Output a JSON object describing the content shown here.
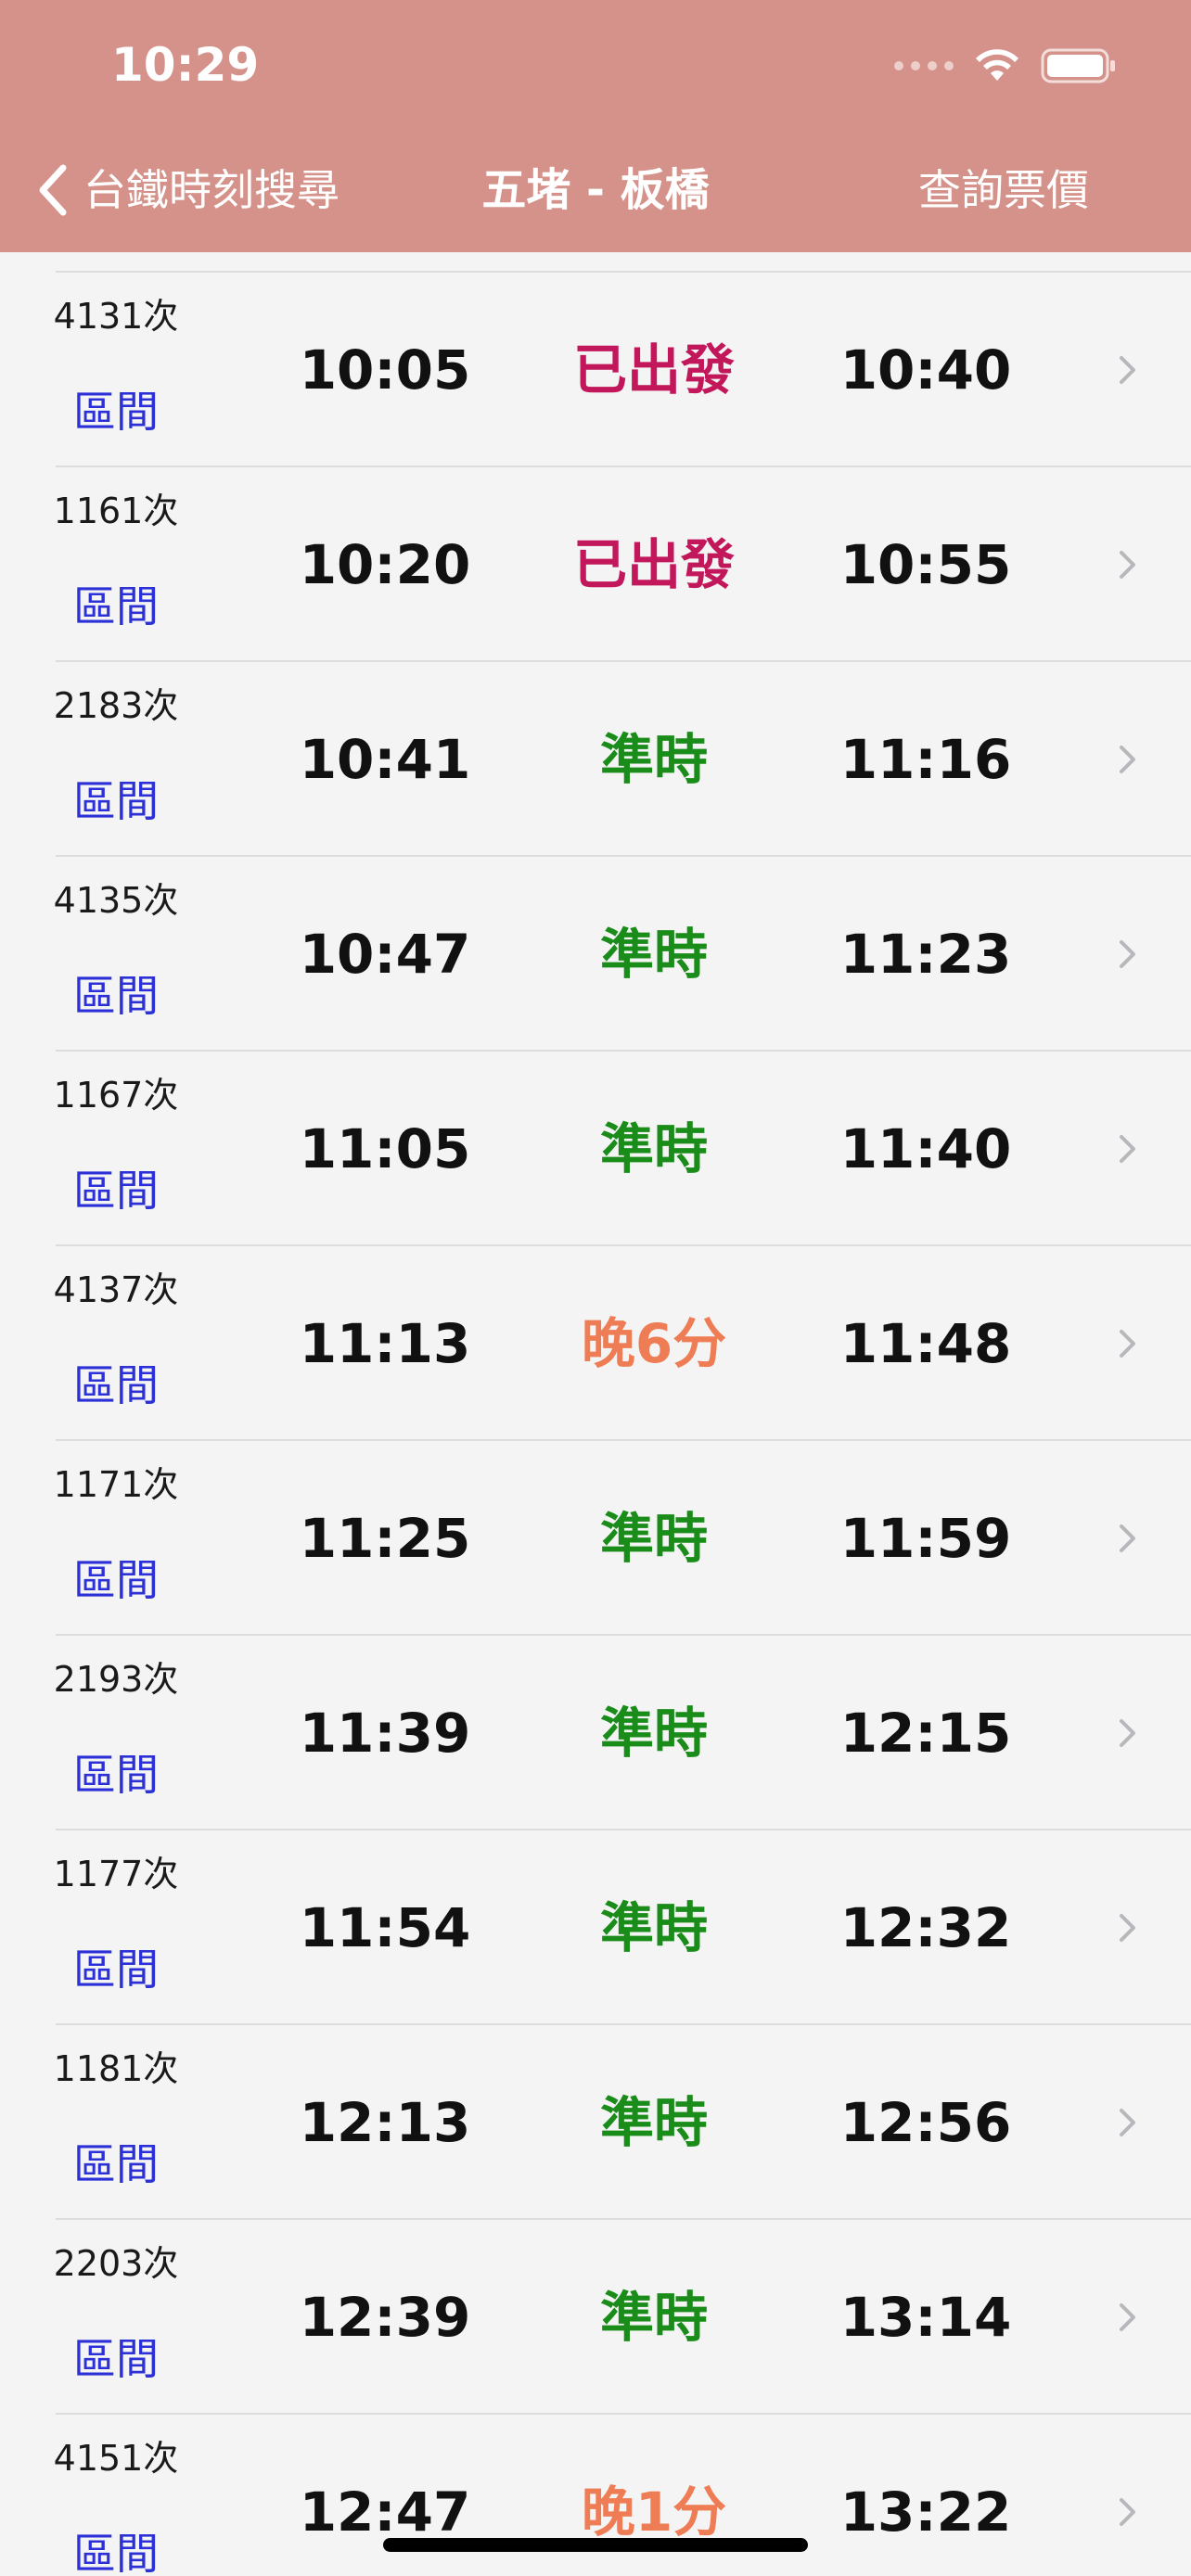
{
  "status_bar": {
    "time": "10:29"
  },
  "nav": {
    "back_label": "台鐵時刻搜尋",
    "title": "五堵 - 板橋",
    "fare_label": "查詢票價"
  },
  "colors": {
    "header_bg": "#d5928a",
    "departed": "#c2185b",
    "on_time": "#1a8c1a",
    "late": "#ee7d55",
    "train_type": "#2b31d6"
  },
  "trains": [
    {
      "no": "4131次",
      "type": "區間",
      "dep": "10:05",
      "status": "已出發",
      "status_kind": "departed",
      "arr": "10:40"
    },
    {
      "no": "1161次",
      "type": "區間",
      "dep": "10:20",
      "status": "已出發",
      "status_kind": "departed",
      "arr": "10:55"
    },
    {
      "no": "2183次",
      "type": "區間",
      "dep": "10:41",
      "status": "準時",
      "status_kind": "on_time",
      "arr": "11:16"
    },
    {
      "no": "4135次",
      "type": "區間",
      "dep": "10:47",
      "status": "準時",
      "status_kind": "on_time",
      "arr": "11:23"
    },
    {
      "no": "1167次",
      "type": "區間",
      "dep": "11:05",
      "status": "準時",
      "status_kind": "on_time",
      "arr": "11:40"
    },
    {
      "no": "4137次",
      "type": "區間",
      "dep": "11:13",
      "status": "晚6分",
      "status_kind": "late",
      "arr": "11:48"
    },
    {
      "no": "1171次",
      "type": "區間",
      "dep": "11:25",
      "status": "準時",
      "status_kind": "on_time",
      "arr": "11:59"
    },
    {
      "no": "2193次",
      "type": "區間",
      "dep": "11:39",
      "status": "準時",
      "status_kind": "on_time",
      "arr": "12:15"
    },
    {
      "no": "1177次",
      "type": "區間",
      "dep": "11:54",
      "status": "準時",
      "status_kind": "on_time",
      "arr": "12:32"
    },
    {
      "no": "1181次",
      "type": "區間",
      "dep": "12:13",
      "status": "準時",
      "status_kind": "on_time",
      "arr": "12:56"
    },
    {
      "no": "2203次",
      "type": "區間",
      "dep": "12:39",
      "status": "準時",
      "status_kind": "on_time",
      "arr": "13:14"
    },
    {
      "no": "4151次",
      "type": "區間",
      "dep": "12:47",
      "status": "晚1分",
      "status_kind": "late",
      "arr": "13:22"
    }
  ]
}
